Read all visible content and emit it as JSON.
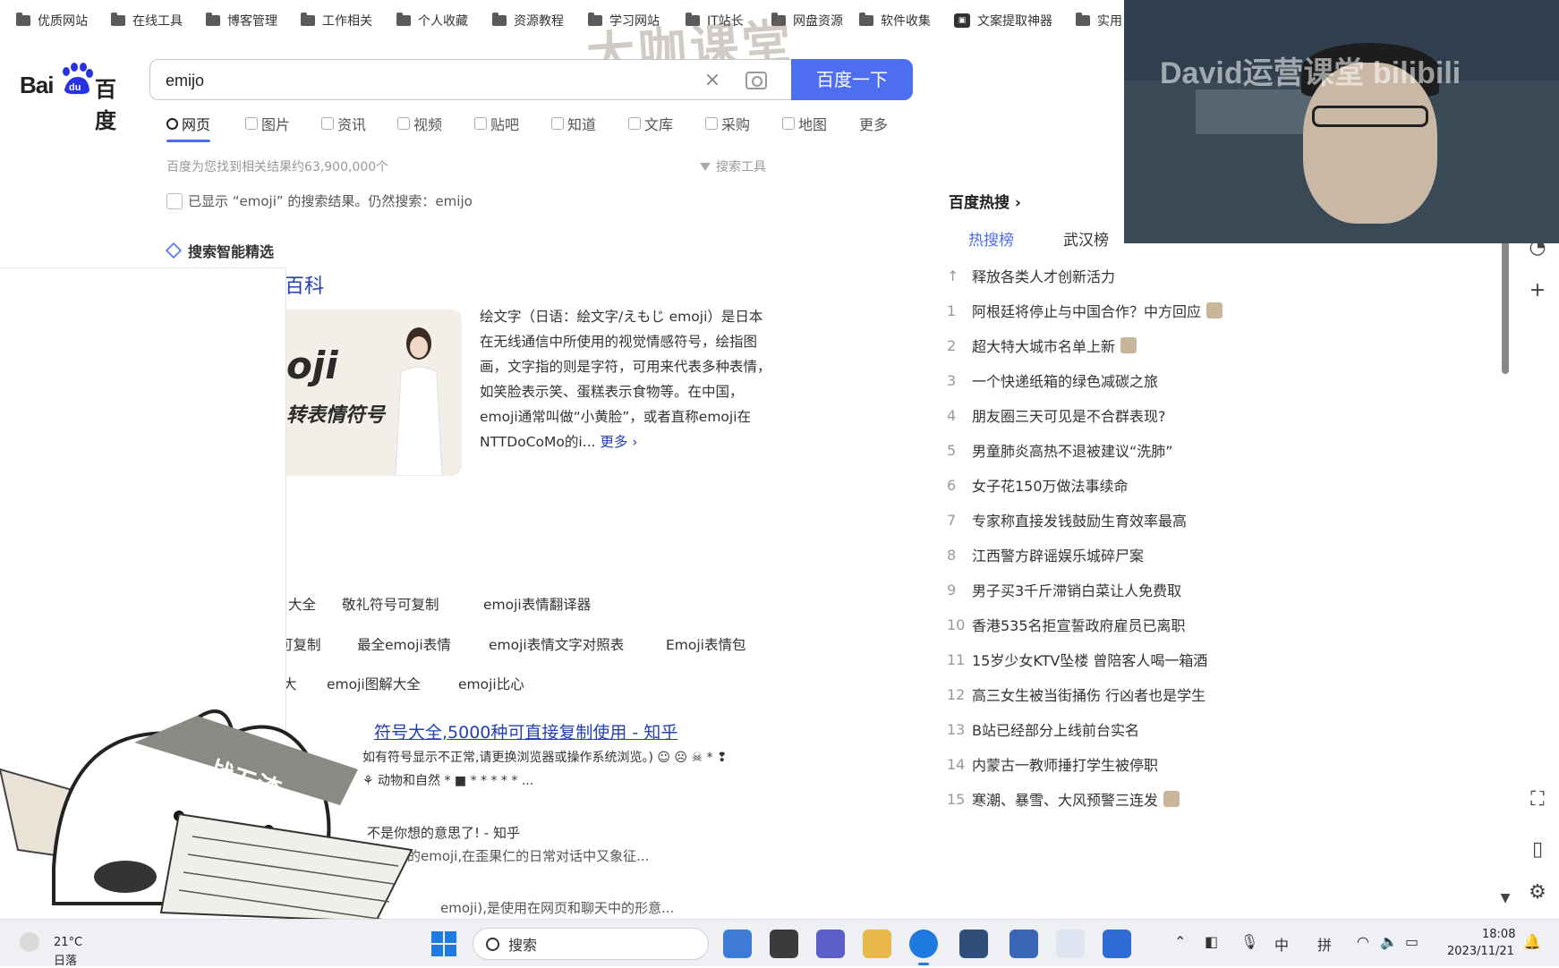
{
  "bookmarks": [
    {
      "label": "优质网站"
    },
    {
      "label": "在线工具"
    },
    {
      "label": "博客管理"
    },
    {
      "label": "工作相关"
    },
    {
      "label": "个人收藏"
    },
    {
      "label": "资源教程"
    },
    {
      "label": "学习网站"
    },
    {
      "label": "IT站长"
    },
    {
      "label": "网盘资源"
    },
    {
      "label": "软件收集"
    },
    {
      "label": "文案提取神器"
    },
    {
      "label": "实用"
    }
  ],
  "logo": {
    "bai": "Bai",
    "du": "du",
    "cn": "百度"
  },
  "search": {
    "value": "emijo",
    "button": "百度一下"
  },
  "tabs": [
    {
      "label": "网页"
    },
    {
      "label": "图片"
    },
    {
      "label": "资讯"
    },
    {
      "label": "视频"
    },
    {
      "label": "贴吧"
    },
    {
      "label": "知道"
    },
    {
      "label": "文库"
    },
    {
      "label": "采购"
    },
    {
      "label": "地图"
    },
    {
      "label": "更多"
    }
  ],
  "result_count": "百度为您找到相关结果约63,900,000个",
  "search_tools": "搜索工具",
  "correction": "已显示 “emoji” 的搜索结果。仍然搜索：emijo",
  "ai_title": "搜索智能精选",
  "baike": {
    "title_tail": "百科",
    "img_big": "oji",
    "img_sub": "转表情符号",
    "desc": "绘文字（日语：絵文字/えもじ emoji）是日本在无线通信中所使用的视觉情感符号，绘指图画，文字指的则是字符，可用来代表多种表情，如笑脸表示笑、蛋糕表示食物等。在中国，emoji通常叫做“小黄脸”，或者直称emoji在NTTDoCoMo的i...",
    "more": "更多 ›"
  },
  "related": [
    {
      "label": "大全"
    },
    {
      "label": "敬礼符号可复制"
    },
    {
      "label": "emoji表情翻译器"
    },
    {
      "label": "可复制"
    },
    {
      "label": "最全emoji表情"
    },
    {
      "label": "emoji表情文字对照表"
    },
    {
      "label": "Emoji表情包"
    },
    {
      "label": "大"
    },
    {
      "label": "emoji图解大全"
    },
    {
      "label": "emoji比心"
    }
  ],
  "results": {
    "zhihu_title": "符号大全,5000种可直接复制使用 - 知乎",
    "zhihu_snippet": "如有符号显示不正常,请更换浏览器或操作系统浏览。) ☺ ☹ ☠ * ❢",
    "zhihu_snippet2": "⚘ 动物和自然 * ■ * * * * * ...",
    "zhihu2_title": "不是你想的意思了! - 知乎",
    "zhihu2_snippet": "蛇的emoji,在歪果仁的日常对话中又象征...",
    "snippet3": "emoji),是使用在网页和聊天中的形意..."
  },
  "hot": {
    "title": "百度热搜 ›",
    "tab1": "热搜榜",
    "tab2": "武汉榜",
    "items": [
      {
        "rank": "↑",
        "text": "释放各类人才创新活力",
        "badge": false
      },
      {
        "rank": "1",
        "text": "阿根廷将停止与中国合作？中方回应",
        "badge": true
      },
      {
        "rank": "2",
        "text": "超大特大城市名单上新",
        "badge": true
      },
      {
        "rank": "3",
        "text": "一个快递纸箱的绿色减碳之旅",
        "badge": false
      },
      {
        "rank": "4",
        "text": "朋友圈三天可见是不合群表现?",
        "badge": false
      },
      {
        "rank": "5",
        "text": "男童肺炎高热不退被建议“洗肺”",
        "badge": false
      },
      {
        "rank": "6",
        "text": "女子花150万做法事续命",
        "badge": false
      },
      {
        "rank": "7",
        "text": "专家称直接发钱鼓励生育效率最高",
        "badge": false
      },
      {
        "rank": "8",
        "text": "江西警方辟谣娱乐城碎尸案",
        "badge": false
      },
      {
        "rank": "9",
        "text": "男子买3千斤滞销白菜让人免费取",
        "badge": false
      },
      {
        "rank": "10",
        "text": "香港535名拒宣誓政府雇员已离职",
        "badge": false
      },
      {
        "rank": "11",
        "text": "15岁少女KTV坠楼 曾陪客人喝一箱酒",
        "badge": false
      },
      {
        "rank": "12",
        "text": "高三女生被当街捅伤 行凶者也是学生",
        "badge": false
      },
      {
        "rank": "13",
        "text": "B站已经部分上线前台实名",
        "badge": false
      },
      {
        "rank": "14",
        "text": "内蒙古一教师捶打学生被停职",
        "badge": false
      },
      {
        "rank": "15",
        "text": "寒潮、暴雪、大风预警三连发",
        "badge": true
      }
    ]
  },
  "webcam": {
    "watermark": "David运营课堂 bilibili"
  },
  "watermark_top": "大咖课堂",
  "cat_banner": "战五渣",
  "taskbar": {
    "temp": "21°C",
    "condition": "日落",
    "search": "搜索",
    "ime1": "中",
    "ime2": "拼",
    "time": "18:08",
    "date": "2023/11/21"
  },
  "colors": {
    "accent": "#4e6ef2",
    "link": "#2440b3"
  }
}
